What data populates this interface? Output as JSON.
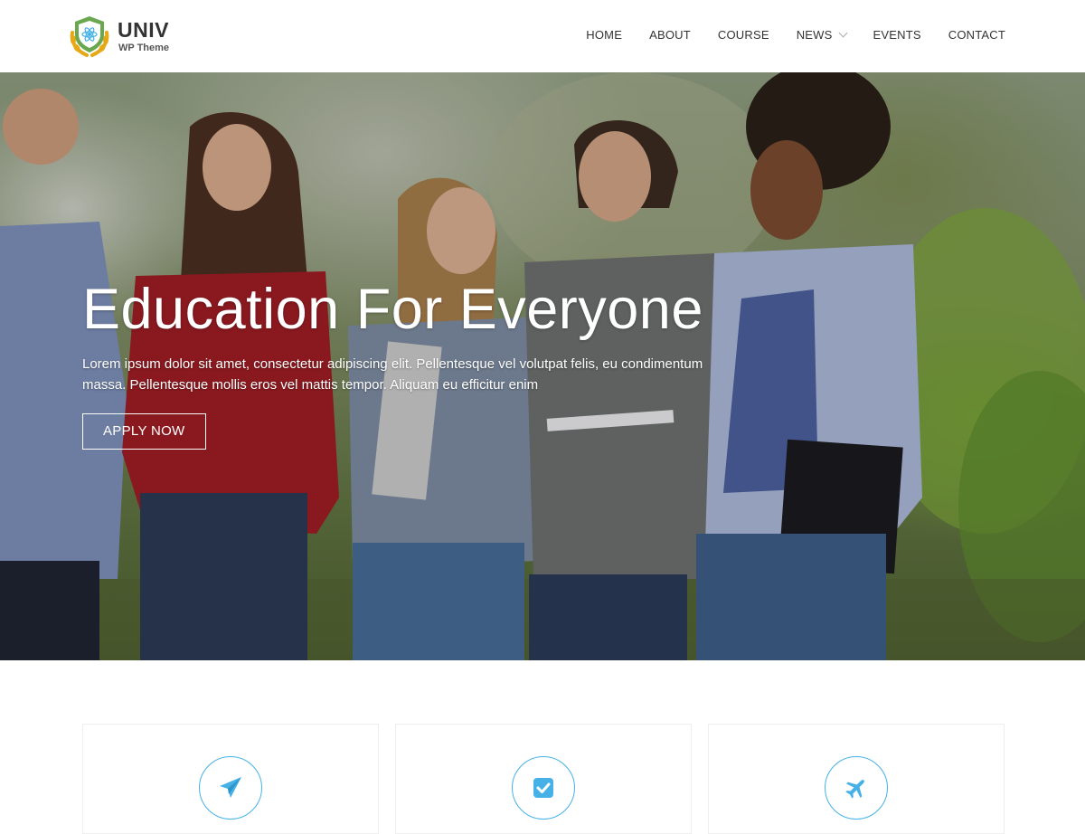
{
  "brand": {
    "title": "UNIV",
    "subtitle": "WP Theme",
    "colors": {
      "shield": "#6aa84f",
      "wreath": "#e6a817",
      "accent": "#46b1e6"
    }
  },
  "nav": {
    "items": [
      {
        "label": "HOME"
      },
      {
        "label": "ABOUT"
      },
      {
        "label": "COURSE"
      },
      {
        "label": "NEWS",
        "has_dropdown": true
      },
      {
        "label": "EVENTS"
      },
      {
        "label": "CONTACT"
      }
    ]
  },
  "hero": {
    "title": "Education For Everyone",
    "text": "Lorem ipsum dolor sit amet, consectetur adipiscing elit. Pellentesque vel volutpat felis, eu condimentum massa. Pellentesque mollis eros vel mattis tempor. Aliquam eu efficitur enim",
    "button_label": "APPLY NOW"
  },
  "features": {
    "cards": [
      {
        "icon": "paper-plane-icon"
      },
      {
        "icon": "check-square-icon"
      },
      {
        "icon": "airplane-icon"
      }
    ]
  }
}
